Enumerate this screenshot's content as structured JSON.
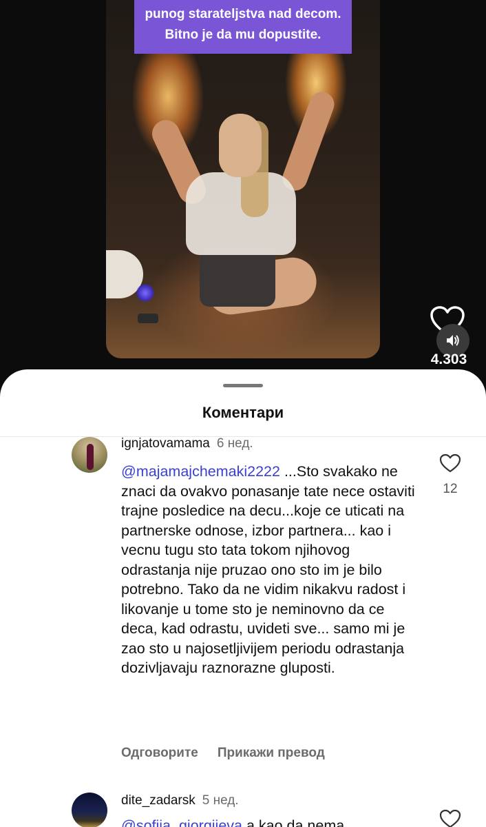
{
  "video": {
    "caption_lines": [
      "punog starateljstva nad decom.",
      "Bitno je da mu dopustite."
    ],
    "like_count": "4.303",
    "icons": [
      "heart-outline-icon",
      "sound-on-icon"
    ],
    "caption_bg": "#7a55d6"
  },
  "sheet": {
    "title": "Коментари"
  },
  "comments": [
    {
      "username": "ignjatovamama",
      "time": "6 нед.",
      "mention": "@majamajchemaki2222",
      "text": " ...Sto svakako ne znaci da ovakvo ponasanje tate nece ostaviti trajne posledice na decu...koje ce uticati na partnerske odnose, izbor partnera... kao i vecnu tugu sto tata tokom njihovog odrastanja nije pruzao ono sto im je bilo potrebno. Tako da ne vidim nikakvu radost i likovanje u tome sto je neminovno da ce deca, kad odrastu, uvideti sve... samo mi je zao sto u najosetljivijem periodu odrastanja dozivljavaju raznorazne gluposti.",
      "likes": "12",
      "reply_label": "Одговорите",
      "translate_label": "Прикажи превод"
    },
    {
      "username": "dite_zadarsk",
      "time": "5 нед.",
      "mention": "@sofija_giorgijeva",
      "text": " a kao da nema"
    }
  ],
  "colors": {
    "mention": "#3a40d0",
    "sheet_bg": "#ffffff",
    "app_bg": "#0c0c0c"
  }
}
